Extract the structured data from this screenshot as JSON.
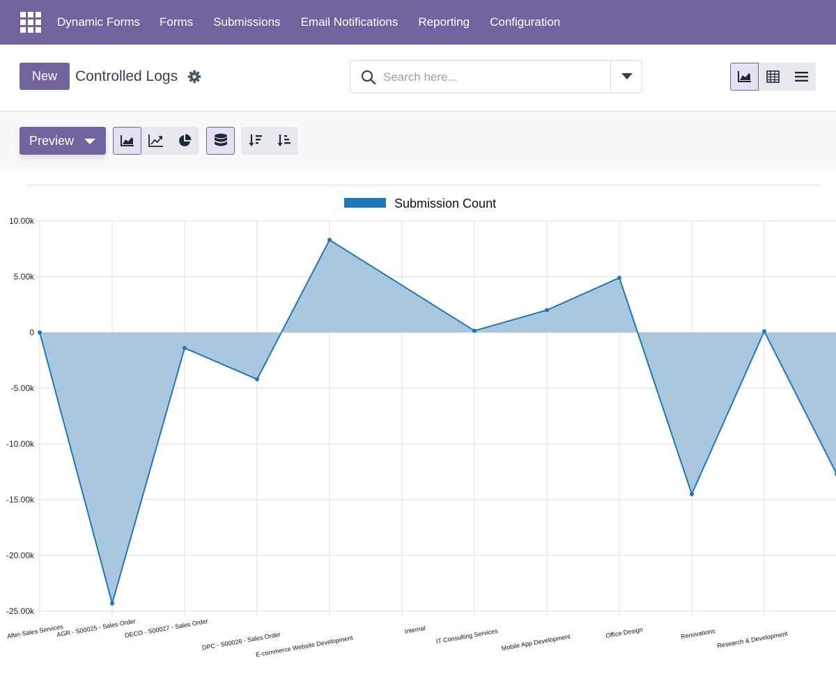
{
  "navbar": {
    "app_name": "Dynamic Forms",
    "menu": [
      "Forms",
      "Submissions",
      "Email Notifications",
      "Reporting",
      "Configuration"
    ]
  },
  "control_panel": {
    "new_label": "New",
    "breadcrumb": "Controlled Logs",
    "search_placeholder": "Search here...",
    "views": [
      "graph-icon",
      "pivot-icon",
      "list-icon"
    ],
    "active_view": "graph"
  },
  "toolbar": {
    "measure_label": "Preview",
    "chart_types": [
      "area-chart-icon",
      "line-chart-icon",
      "pie-chart-icon"
    ],
    "stacked_icon": "database-stack-icon",
    "sort_icons": [
      "sort-descending-icon",
      "sort-ascending-icon"
    ]
  },
  "colors": {
    "brand": "#71639e",
    "series_line": "#1f77b4",
    "series_fill": "#a9c8e0"
  },
  "chart_data": {
    "type": "area",
    "legend": [
      "Submission Count"
    ],
    "legend_position": "top-center",
    "categories": [
      "After-Sales Services",
      "AGR - S00025 - Sales Order",
      "DECO - S00027 - Sales Order",
      "DPC - S00026 - Sales Order",
      "E-commerce Website Development",
      "Internal",
      "IT Consulting Services",
      "Mobile App Development",
      "Office Design",
      "Renovations",
      "Research & Development"
    ],
    "series": [
      {
        "name": "Submission Count",
        "points": [
          {
            "x": 0,
            "y": 0
          },
          {
            "x": 1,
            "y": -24300
          },
          {
            "x": 2,
            "y": -1400
          },
          {
            "x": 3,
            "y": -4200
          },
          {
            "x": 4,
            "y": 8300
          },
          {
            "x": 6,
            "y": 150
          },
          {
            "x": 7,
            "y": 2000
          },
          {
            "x": 8,
            "y": 4900
          },
          {
            "x": 9,
            "y": -14500
          },
          {
            "x": 10,
            "y": 100
          },
          {
            "x": 11,
            "y": -12700
          }
        ]
      }
    ],
    "yticks": [
      "10.00k",
      "5.00k",
      "0",
      "-5.00k",
      "-10.00k",
      "-15.00k",
      "-20.00k",
      "-25.00k"
    ],
    "ylim": [
      -25000,
      10000
    ],
    "grid": true
  }
}
